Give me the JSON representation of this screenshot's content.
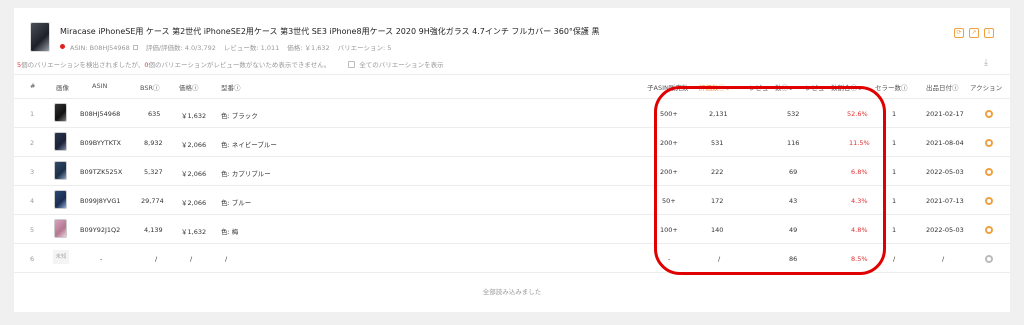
{
  "product": {
    "title": "Miracase iPhoneSE用 ケース 第2世代 iPhoneSE2用ケース 第3世代 SE3 iPhone8用ケース 2020 9H強化ガラス 4.7インチ フルカバー 360°保護 黒",
    "asin": "ASIN: B08HJ54968",
    "rating_reviews": "評価/評価数: 4.0/3,792",
    "review_count": "レビュー数: 1,011",
    "price": "価格: ￥1,632",
    "variations": "バリエーション: 5"
  },
  "notice": {
    "n1": "5",
    "t1": "個のバリエーションを検出されましたが、",
    "n2": "0",
    "t2": "個のバリエーションがレビュー数がないため表示できません。",
    "checkbox_label": "全てのバリエーションを表示"
  },
  "toolbar_icons": [
    "refresh-icon",
    "share-icon",
    "export-icon",
    "download-icon"
  ],
  "columns": {
    "num": "#",
    "image": "画像",
    "asin": "ASIN",
    "bsr": "BSR",
    "price": "価格",
    "model": "型番",
    "child_asin_sales": "子ASIN販売数",
    "rating_count": "評価数",
    "review_count": "レビュー数",
    "review_ratio": "レビュー数割合",
    "seller_count": "セラー数",
    "launch_date": "出品日付",
    "action": "アクション"
  },
  "rows": [
    {
      "num": "1",
      "asin": "B08HJ54968",
      "bsr": "635",
      "price": "￥1,632",
      "model": "色: ブラック",
      "sales": "500+",
      "ratings": "2,131",
      "reviews": "532",
      "ratio": "52.6%",
      "sellers": "1",
      "date": "2021-02-17"
    },
    {
      "num": "2",
      "asin": "B09BYYTKTX",
      "bsr": "8,932",
      "price": "￥2,066",
      "model": "色: ネイビーブルー",
      "sales": "200+",
      "ratings": "531",
      "reviews": "116",
      "ratio": "11.5%",
      "sellers": "1",
      "date": "2021-08-04"
    },
    {
      "num": "3",
      "asin": "B09TZK525X",
      "bsr": "5,327",
      "price": "￥2,066",
      "model": "色: カプリブルー",
      "sales": "200+",
      "ratings": "222",
      "reviews": "69",
      "ratio": "6.8%",
      "sellers": "1",
      "date": "2022-05-03"
    },
    {
      "num": "4",
      "asin": "B099J8YVG1",
      "bsr": "29,774",
      "price": "￥2,066",
      "model": "色: ブルー",
      "sales": "50+",
      "ratings": "172",
      "reviews": "43",
      "ratio": "4.3%",
      "sellers": "1",
      "date": "2021-07-13"
    },
    {
      "num": "5",
      "asin": "B09Y92J1Q2",
      "bsr": "4,139",
      "price": "￥1,632",
      "model": "色: 梅",
      "sales": "100+",
      "ratings": "140",
      "reviews": "49",
      "ratio": "4.8%",
      "sellers": "1",
      "date": "2022-05-03"
    },
    {
      "num": "6",
      "image_label": "未知",
      "asin": "-",
      "bsr": "/",
      "price": "/",
      "model": "/",
      "sales": "-",
      "ratings": "/",
      "reviews": "86",
      "ratio": "8.5%",
      "sellers": "/",
      "date": "/"
    }
  ],
  "footer": "全部読み込みました",
  "colors": {
    "accent": "#f08a24",
    "highlight_ring": "#e00000",
    "ratio_text": "#e03030"
  }
}
